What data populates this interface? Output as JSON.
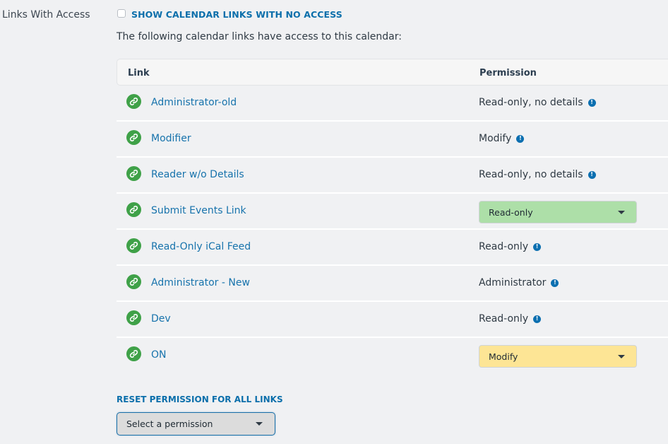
{
  "section": {
    "label": "Links With Access"
  },
  "show_no_access": {
    "label": "SHOW CALENDAR LINKS WITH NO ACCESS",
    "checked": false
  },
  "intro_text": "The following calendar links have access to this calendar:",
  "table": {
    "columns": [
      "Link",
      "Permission"
    ],
    "rows": [
      {
        "link": "Administrator-old",
        "permission": "Read-only, no details",
        "type": "text"
      },
      {
        "link": "Modifier",
        "permission": "Modify",
        "type": "text"
      },
      {
        "link": "Reader w/o Details",
        "permission": "Read-only, no details",
        "type": "text"
      },
      {
        "link": "Submit Events Link",
        "permission": "Read-only",
        "type": "select",
        "color": "#addfa8"
      },
      {
        "link": "Read-Only iCal Feed",
        "permission": "Read-only",
        "type": "text"
      },
      {
        "link": "Administrator - New",
        "permission": "Administrator",
        "type": "text"
      },
      {
        "link": "Dev",
        "permission": "Read-only",
        "type": "text"
      },
      {
        "link": "ON",
        "permission": "Modify",
        "type": "select",
        "color": "#fde595"
      }
    ]
  },
  "icons": {
    "link": "link-icon",
    "info": "info-icon",
    "info_glyph": "!",
    "caret": "caret-down-icon"
  },
  "reset": {
    "label": "RESET PERMISSION FOR ALL LINKS",
    "placeholder": "Select a permission"
  },
  "colors": {
    "accent": "#0b6fab",
    "link_icon_bg": "#3fa148",
    "readonly_select": "#addfa8",
    "modify_select": "#fde595"
  }
}
